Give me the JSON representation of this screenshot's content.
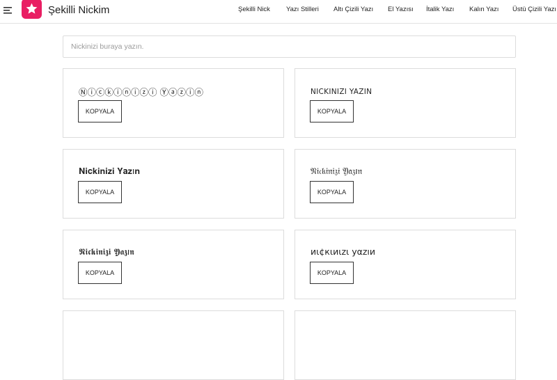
{
  "header": {
    "brand": "Şekilli Nickim",
    "nav": [
      "Şekilli Nick",
      "Yazı Stilleri",
      "Altı Çizili Yazı",
      "El Yazısı",
      "İtalik Yazı",
      "Kalın Yazı",
      "Üstü Çizili Yazı"
    ]
  },
  "search": {
    "placeholder": "Nickinizi buraya yazın.",
    "value": ""
  },
  "cards": [
    {
      "text": "Ⓝⓘⓒⓚⓘⓝⓘⓩⓘ Ⓨⓐⓩⓘⓝ",
      "button": "KOPYALA"
    },
    {
      "text": "NICKINIZI YAZIN",
      "button": "KOPYALA"
    },
    {
      "text": "𝐍𝐢𝐜𝐤𝐢𝐧𝐢𝐳𝐢 𝐘𝐚𝐳ı𝐧",
      "button": "KOPYALA"
    },
    {
      "text": "𝔑𝔦𝔠𝔨𝔦𝔫𝔦𝔷𝔦 𝔜𝔞𝔷ı𝔫",
      "button": "KOPYALA"
    },
    {
      "text": "𝕹𝖎𝖈𝖐𝖎𝖓𝖎𝖟𝖎 𝖄𝖆𝖟ı𝖓",
      "button": "KOPYALA"
    },
    {
      "text": "иι¢кιиιzι уαzıи",
      "button": "KOPYALA"
    }
  ],
  "colors": {
    "brand": "#e91e63",
    "border": "#dcdcdc",
    "button_border": "#333333"
  }
}
